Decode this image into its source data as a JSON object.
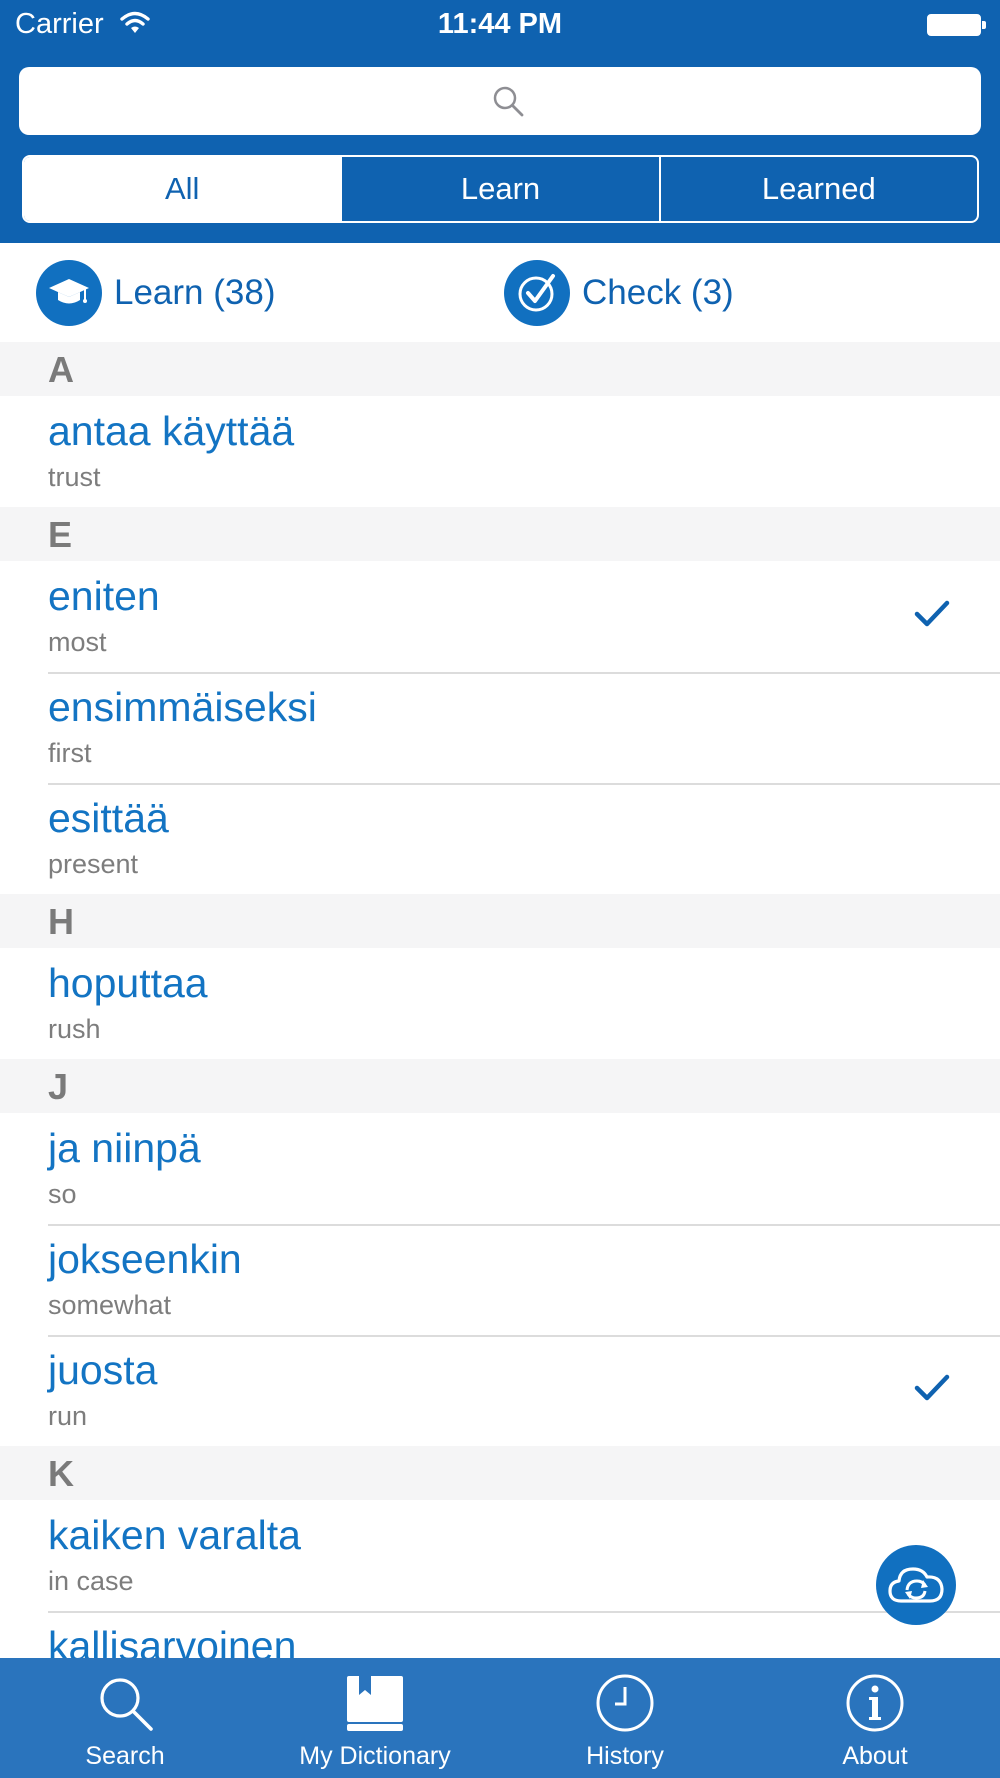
{
  "status_bar": {
    "carrier": "Carrier",
    "time": "11:44 PM"
  },
  "search": {
    "placeholder": ""
  },
  "segments": [
    "All",
    "Learn",
    "Learned"
  ],
  "active_segment": "All",
  "actions": {
    "learn_label": "Learn (38)",
    "check_label": "Check (3)"
  },
  "sections": [
    {
      "letter": "A",
      "rows": [
        {
          "term": "antaa käyttää",
          "translation": "trust",
          "checked": false
        }
      ]
    },
    {
      "letter": "E",
      "rows": [
        {
          "term": "eniten",
          "translation": "most",
          "checked": true
        },
        {
          "term": "ensimmäiseksi",
          "translation": "first",
          "checked": false
        },
        {
          "term": "esittää",
          "translation": "present",
          "checked": false
        }
      ]
    },
    {
      "letter": "H",
      "rows": [
        {
          "term": "hoputtaa",
          "translation": "rush",
          "checked": false
        }
      ]
    },
    {
      "letter": "J",
      "rows": [
        {
          "term": "ja niinpä",
          "translation": "so",
          "checked": false
        },
        {
          "term": "jokseenkin",
          "translation": "somewhat",
          "checked": false
        },
        {
          "term": "juosta",
          "translation": "run",
          "checked": true
        }
      ]
    },
    {
      "letter": "K",
      "rows": [
        {
          "term": "kaiken varalta",
          "translation": "in case",
          "checked": false
        },
        {
          "term": "kallisarvoinen",
          "translation": "",
          "checked": false
        }
      ]
    }
  ],
  "tabs": [
    {
      "label": "Search",
      "icon": "search-icon"
    },
    {
      "label": "My Dictionary",
      "icon": "book-icon"
    },
    {
      "label": "History",
      "icon": "clock-icon"
    },
    {
      "label": "About",
      "icon": "info-icon"
    }
  ],
  "colors": {
    "primary": "#0f62b0",
    "tab_bar": "#2a74bd",
    "term": "#1374c3",
    "section_bg": "#f5f5f6"
  }
}
